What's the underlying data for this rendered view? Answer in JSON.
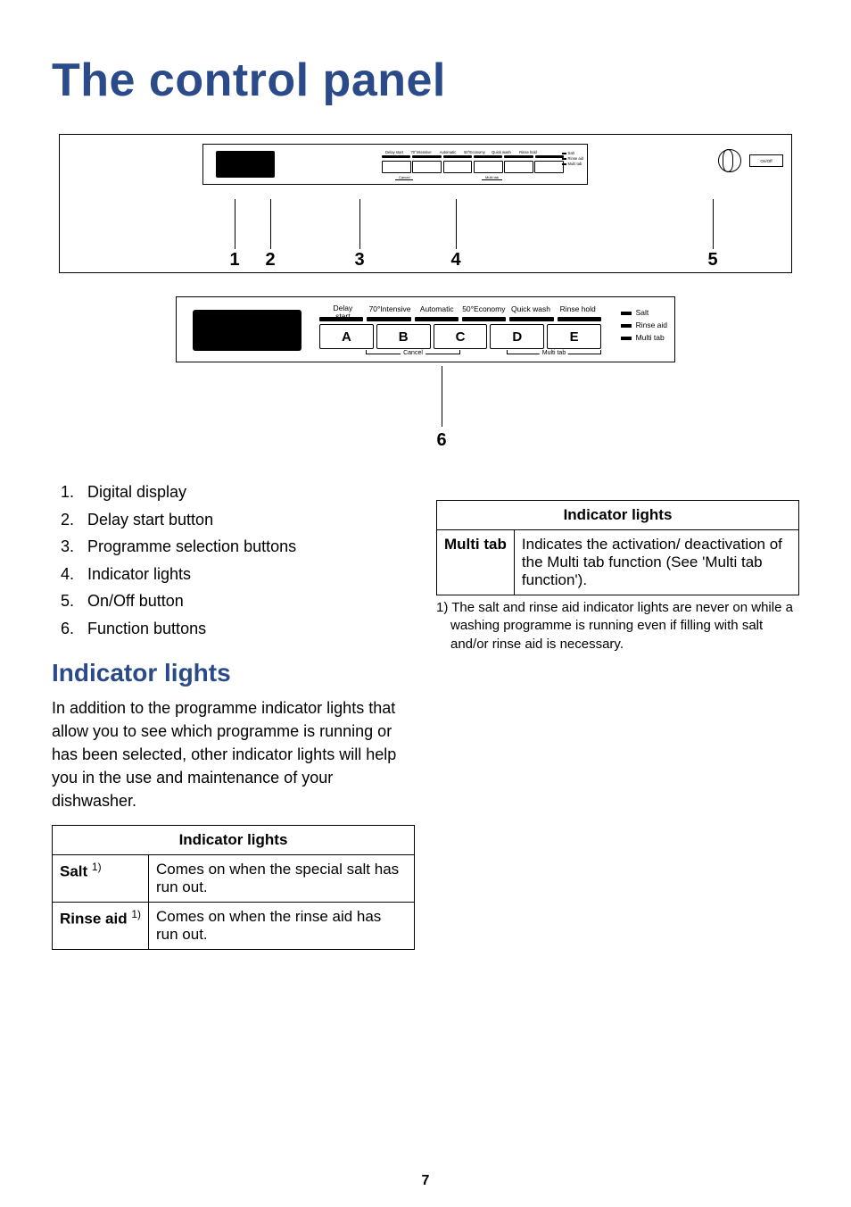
{
  "title": "The control panel",
  "diagram_main": {
    "header_labels": [
      "Delay start",
      "70°Intensive",
      "Automatic",
      "50°Economy",
      "Quick wash",
      "Rinse hold"
    ],
    "indicator_labels": [
      "Salt",
      "Rinse aid",
      "Multi tab"
    ],
    "onoff": "On/Off",
    "sub_cancel": "Cancel",
    "sub_multi": "Multi tab",
    "callouts": [
      "1",
      "2",
      "3",
      "4",
      "5"
    ]
  },
  "diagram_detail": {
    "delay": "Delay\nstart",
    "header_labels": [
      "70°Intensive",
      "Automatic",
      "50°Economy",
      "Quick wash",
      "Rinse hold"
    ],
    "button_letters": [
      "A",
      "B",
      "C",
      "D",
      "E"
    ],
    "indicator_labels": [
      "Salt",
      "Rinse aid",
      "Multi tab"
    ],
    "sub_cancel": "Cancel",
    "sub_multi": "Multi tab",
    "callout": "6"
  },
  "list": [
    "Digital display",
    "Delay start button",
    "Programme selection buttons",
    "Indicator lights",
    "On/Off button",
    "Function buttons"
  ],
  "section_heading": "Indicator lights",
  "section_para": "In addition to the programme indicator lights that allow you to see which programme is running or has been selected, other indicator lights will help you in the use and maintenance of your dishwasher.",
  "table_left": {
    "header": "Indicator lights",
    "rows": [
      {
        "label": "Salt",
        "sup": "1)",
        "desc": "Comes on when the special salt has run out."
      },
      {
        "label": "Rinse aid",
        "sup": "1)",
        "desc": "Comes on when the rinse aid has run out."
      }
    ]
  },
  "table_right": {
    "header": "Indicator lights",
    "rows": [
      {
        "label": "Multi tab",
        "sup": "",
        "desc": "Indicates the activation/ deactivation of the Multi tab function (See 'Multi tab function')."
      }
    ]
  },
  "footnote": "1) The salt and rinse aid indicator lights are never on while a washing programme is running even if filling with salt and/or rinse aid is necessary.",
  "page_number": "7"
}
